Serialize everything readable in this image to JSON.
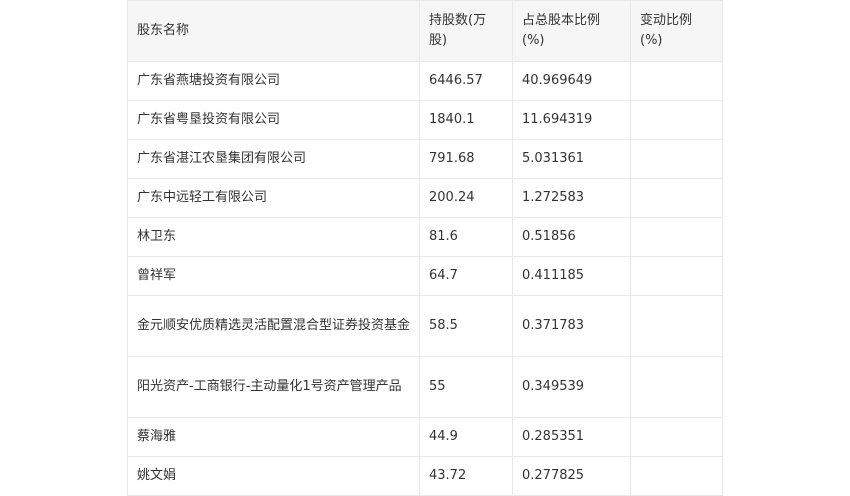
{
  "table": {
    "headers": [
      "股东名称",
      "持股数(万股)",
      "占总股本比例(%)",
      "变动比例(%)"
    ],
    "rows": [
      [
        "广东省燕塘投资有限公司",
        "6446.57",
        "40.969649",
        ""
      ],
      [
        "广东省粤垦投资有限公司",
        "1840.1",
        "11.694319",
        ""
      ],
      [
        "广东省湛江农垦集团有限公司",
        "791.68",
        "5.031361",
        ""
      ],
      [
        "广东中远轻工有限公司",
        "200.24",
        "1.272583",
        ""
      ],
      [
        "林卫东",
        "81.6",
        "0.51856",
        ""
      ],
      [
        "曾祥军",
        "64.7",
        "0.411185",
        ""
      ],
      [
        "金元顺安优质精选灵活配置混合型证券投资基金",
        "58.5",
        "0.371783",
        ""
      ],
      [
        "阳光资产-工商银行-主动量化1号资产管理产品",
        "55",
        "0.349539",
        ""
      ],
      [
        "蔡海雅",
        "44.9",
        "0.285351",
        ""
      ],
      [
        "姚文娟",
        "43.72",
        "0.277825",
        ""
      ]
    ]
  }
}
